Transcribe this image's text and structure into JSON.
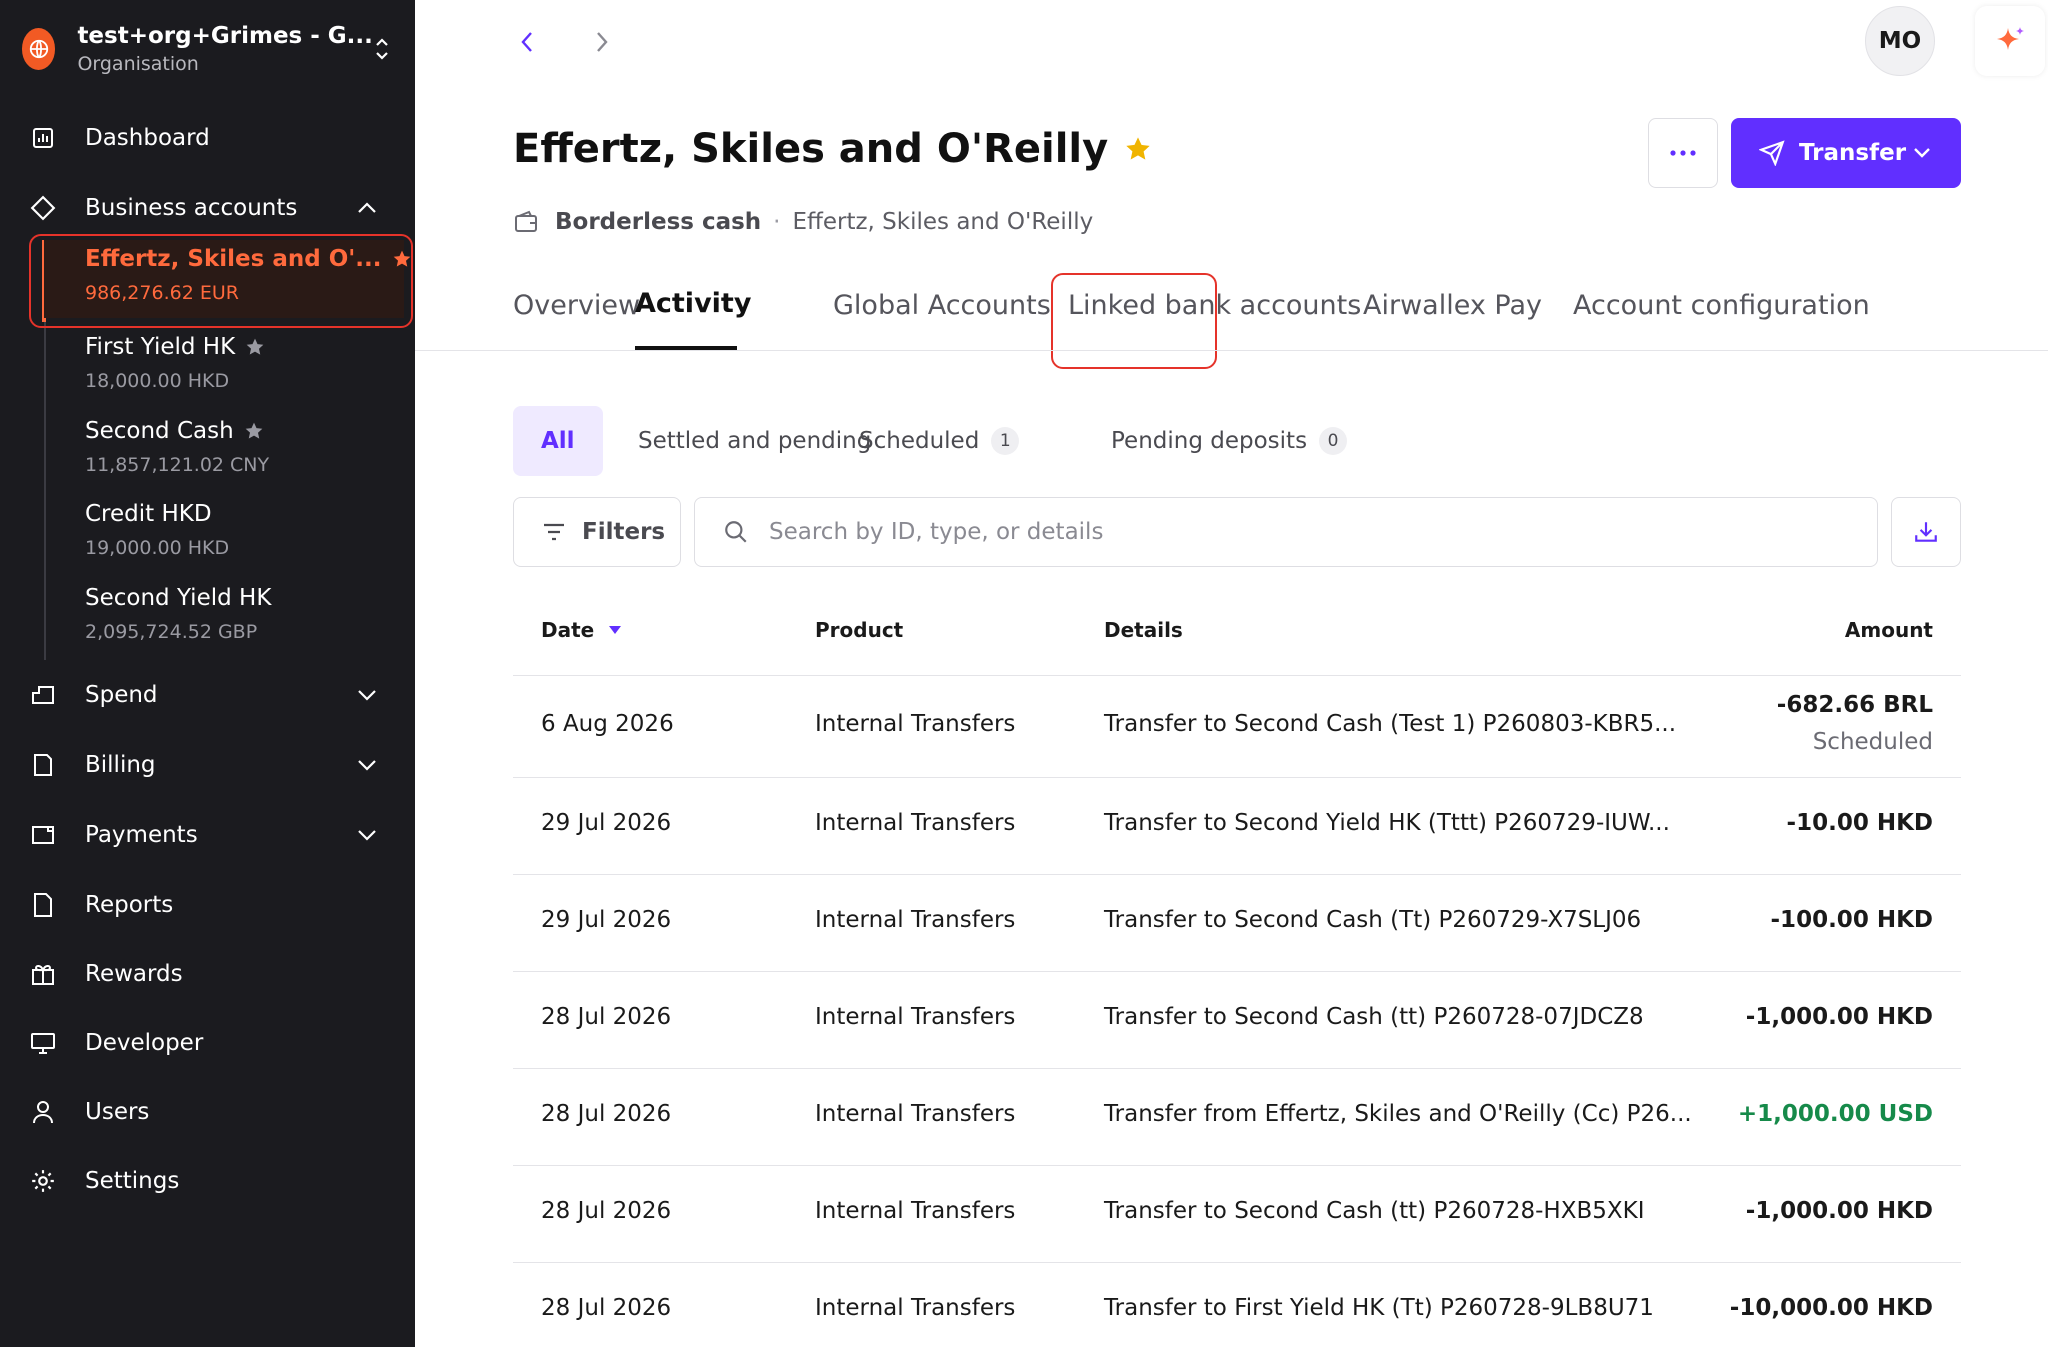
{
  "org": {
    "name": "test+org+Grimes - G...",
    "subtitle": "Organisation"
  },
  "nav": {
    "dashboard": "Dashboard",
    "business_accounts": "Business accounts",
    "spend": "Spend",
    "billing": "Billing",
    "payments": "Payments",
    "reports": "Reports",
    "rewards": "Rewards",
    "developer": "Developer",
    "users": "Users",
    "settings": "Settings"
  },
  "accounts": [
    {
      "name": "Effertz, Skiles and O'...",
      "balance": "986,276.62 EUR",
      "starred": true,
      "active": true
    },
    {
      "name": "First Yield HK",
      "balance": "18,000.00 HKD",
      "starred": true
    },
    {
      "name": "Second Cash",
      "balance": "11,857,121.02 CNY",
      "starred": true
    },
    {
      "name": "Credit HKD",
      "balance": "19,000.00 HKD",
      "starred": false
    },
    {
      "name": "Second Yield HK",
      "balance": "2,095,724.52 GBP",
      "starred": false
    }
  ],
  "header": {
    "avatar_initials": "MO"
  },
  "page": {
    "title": "Effertz, Skiles and O'Reilly",
    "breadcrumb_type": "Borderless cash",
    "breadcrumb_separator": "·",
    "breadcrumb_account": "Effertz, Skiles and O'Reilly",
    "transfer_label": "Transfer"
  },
  "tabs": [
    "Overview",
    "Activity",
    "Global Accounts",
    "Linked bank accounts",
    "Airwallex Pay",
    "Account configuration"
  ],
  "active_tab": "Activity",
  "filter_chips": [
    {
      "label": "All",
      "active": true
    },
    {
      "label": "Settled and pending"
    },
    {
      "label": "Scheduled",
      "count": "1"
    },
    {
      "label": "Pending deposits",
      "count": "0"
    }
  ],
  "toolbar": {
    "filters_label": "Filters",
    "search_placeholder": "Search by ID, type, or details"
  },
  "table": {
    "columns": {
      "date": "Date",
      "product": "Product",
      "details": "Details",
      "amount": "Amount"
    },
    "rows": [
      {
        "date": "6 Aug 2026",
        "product": "Internal Transfers",
        "details": "Transfer to Second Cash (Test 1) P260803-KBR5...",
        "amount": "-682.66 BRL",
        "status": "Scheduled"
      },
      {
        "date": "29 Jul 2026",
        "product": "Internal Transfers",
        "details": "Transfer to Second Yield HK (Tttt) P260729-IUW...",
        "amount": "-10.00 HKD"
      },
      {
        "date": "29 Jul 2026",
        "product": "Internal Transfers",
        "details": "Transfer to Second Cash (Tt) P260729-X7SLJ06",
        "amount": "-100.00 HKD"
      },
      {
        "date": "28 Jul 2026",
        "product": "Internal Transfers",
        "details": "Transfer to Second Cash (tt) P260728-07JDCZ8",
        "amount": "-1,000.00 HKD"
      },
      {
        "date": "28 Jul 2026",
        "product": "Internal Transfers",
        "details": "Transfer from Effertz, Skiles and O'Reilly (Cc) P26...",
        "amount": "+1,000.00 USD"
      },
      {
        "date": "28 Jul 2026",
        "product": "Internal Transfers",
        "details": "Transfer to Second Cash (tt) P260728-HXB5XKI",
        "amount": "-1,000.00 HKD"
      },
      {
        "date": "28 Jul 2026",
        "product": "Internal Transfers",
        "details": "Transfer to First Yield HK (Tt) P260728-9LB8U71",
        "amount": "-10,000.00 HKD"
      }
    ]
  },
  "colors": {
    "accent": "#612fff",
    "brand_orange": "#f25a24",
    "active_account": "#ff6a3d",
    "highlight_outline": "#e5332a",
    "positive": "#168a4a",
    "sidebar_bg": "#1b1b1f"
  }
}
